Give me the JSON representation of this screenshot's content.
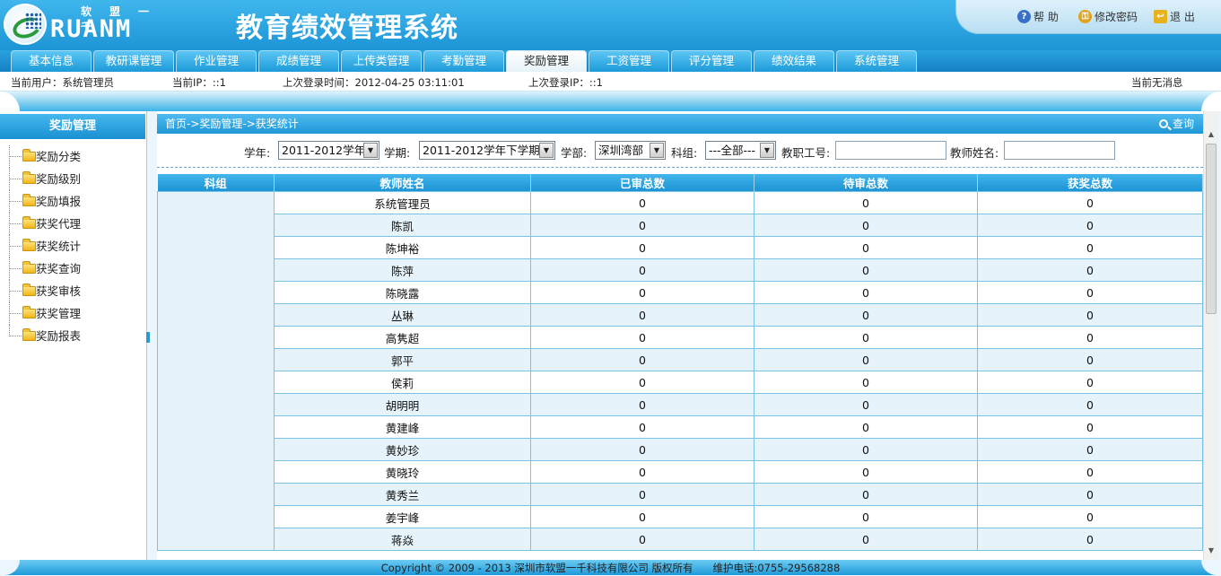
{
  "header": {
    "logo_cn": "软盟一千",
    "logo_en": "RUANM",
    "system_title": "教育绩效管理系统",
    "links": [
      {
        "label": "帮 助",
        "icon": "help-icon"
      },
      {
        "label": "修改密码",
        "icon": "key-icon"
      },
      {
        "label": "退 出",
        "icon": "logout-icon"
      }
    ]
  },
  "nav": {
    "tabs": [
      "基本信息",
      "教研课管理",
      "作业管理",
      "成绩管理",
      "上传类管理",
      "考勤管理",
      "奖励管理",
      "工资管理",
      "评分管理",
      "绩效结果",
      "系统管理"
    ],
    "active": "奖励管理"
  },
  "info_bar": {
    "current_user": "当前用户：系统管理员",
    "current_ip": "当前IP：::1",
    "last_login_time": "上次登录时间：2012-04-25 03:11:01",
    "last_login_ip": "上次登录IP：::1",
    "messages": "当前无消息"
  },
  "sidebar": {
    "title": "奖励管理",
    "items": [
      "奖励分类",
      "奖励级别",
      "奖励填报",
      "获奖代理",
      "获奖统计",
      "获奖查询",
      "获奖审核",
      "获奖管理",
      "奖励报表"
    ]
  },
  "breadcrumb": "首页->奖励管理->获奖统计",
  "query_label": "查询",
  "filters": {
    "year_label": "学年:",
    "year_value": "2011-2012学年",
    "term_label": "学期:",
    "term_value": "2011-2012学年下学期",
    "dept_label": "学部:",
    "dept_value": "深圳湾部",
    "subject_label": "科组:",
    "subject_value": "---全部---",
    "staff_id_label": "教职工号:",
    "staff_id_value": "",
    "teacher_name_label": "教师姓名:",
    "teacher_name_value": ""
  },
  "table": {
    "headers": [
      "科组",
      "教师姓名",
      "已审总数",
      "待审总数",
      "获奖总数"
    ],
    "group_value": "",
    "rows": [
      [
        "系统管理员",
        "0",
        "0",
        "0"
      ],
      [
        "陈凯",
        "0",
        "0",
        "0"
      ],
      [
        "陈坤裕",
        "0",
        "0",
        "0"
      ],
      [
        "陈萍",
        "0",
        "0",
        "0"
      ],
      [
        "陈晓露",
        "0",
        "0",
        "0"
      ],
      [
        "丛琳",
        "0",
        "0",
        "0"
      ],
      [
        "高隽超",
        "0",
        "0",
        "0"
      ],
      [
        "郭平",
        "0",
        "0",
        "0"
      ],
      [
        "侯莉",
        "0",
        "0",
        "0"
      ],
      [
        "胡明明",
        "0",
        "0",
        "0"
      ],
      [
        "黄建峰",
        "0",
        "0",
        "0"
      ],
      [
        "黄妙珍",
        "0",
        "0",
        "0"
      ],
      [
        "黄晓玲",
        "0",
        "0",
        "0"
      ],
      [
        "黄秀兰",
        "0",
        "0",
        "0"
      ],
      [
        "姜宇峰",
        "0",
        "0",
        "0"
      ],
      [
        "蒋焱",
        "0",
        "0",
        "0"
      ]
    ]
  },
  "footer": {
    "copyright": "Copyright © 2009 - 2013 深圳市软盟一千科技有限公司 版权所有",
    "phone": "维护电话:0755-29568288"
  },
  "colors": {
    "header_blue": "#1d95d6",
    "tab_active": "#ffffff",
    "alt_row": "#e6f3fa"
  }
}
